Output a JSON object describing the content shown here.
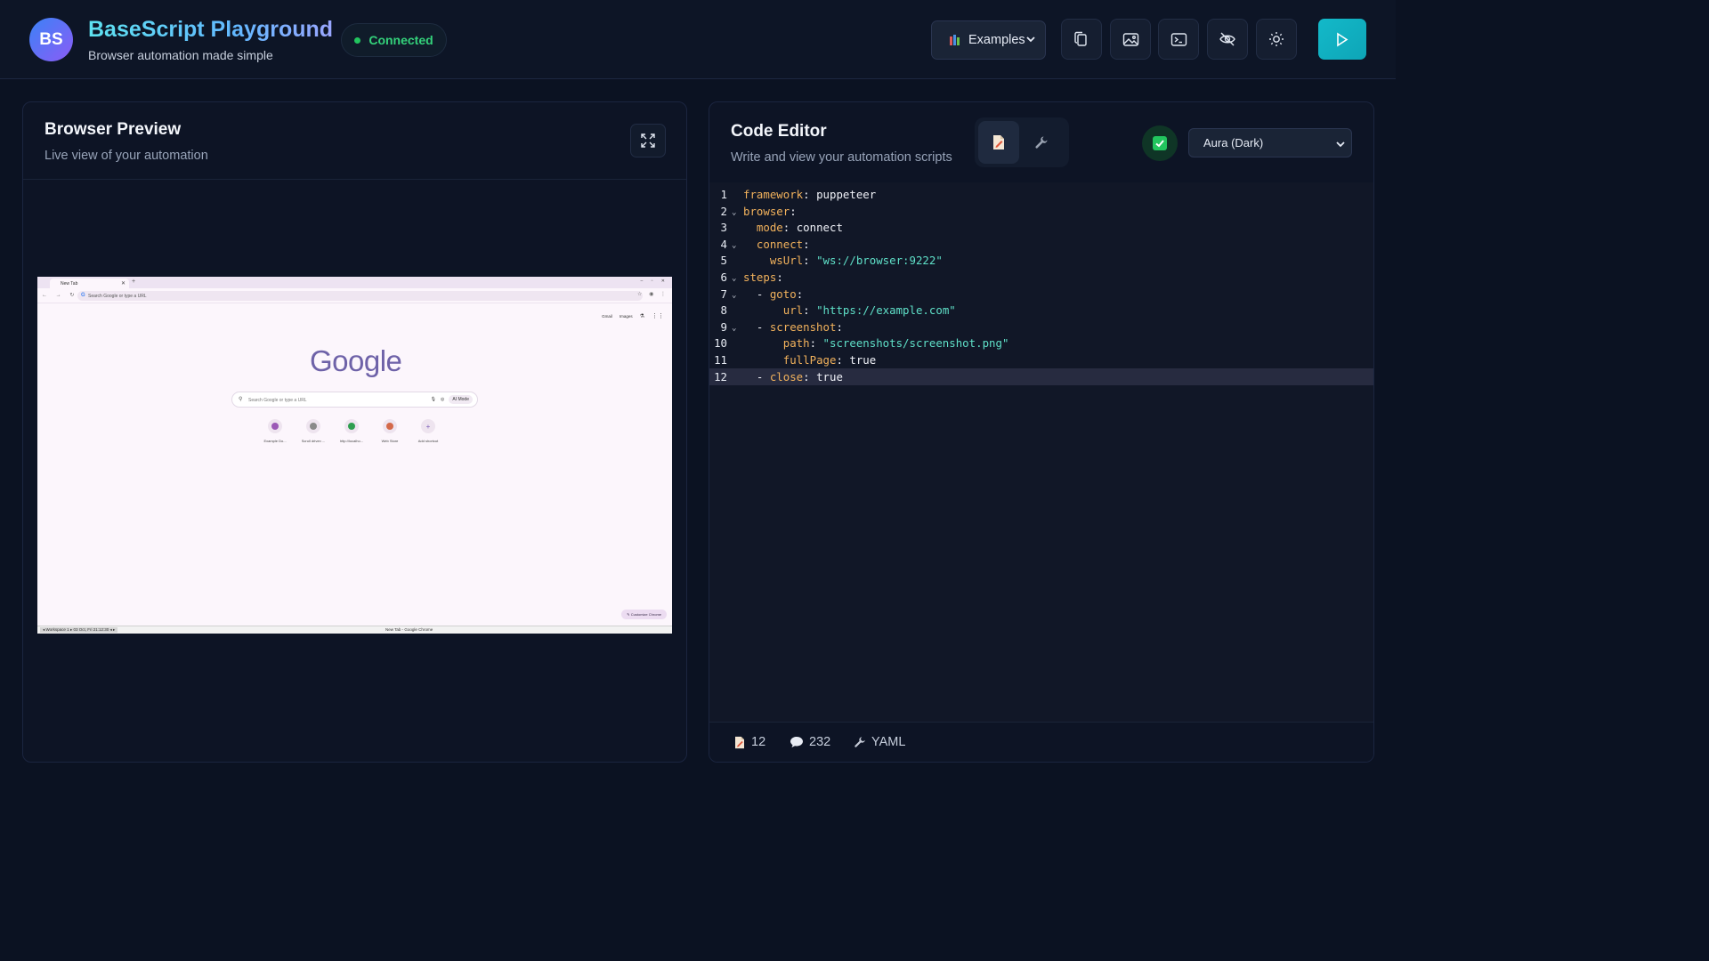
{
  "header": {
    "avatar_initials": "BS",
    "title": "BaseScript Playground",
    "subtitle": "Browser automation made simple",
    "status": "Connected",
    "examples_label": "Examples",
    "icons": [
      "copy-icon",
      "image-icon",
      "terminal-icon",
      "eye-off-icon",
      "sun-icon",
      "play-icon"
    ]
  },
  "preview": {
    "title": "Browser Preview",
    "subtitle": "Live view of your automation",
    "browser": {
      "tab_title": "New Tab",
      "omnibox_placeholder": "Search Google or type a URL",
      "top_links": [
        "Gmail",
        "Images"
      ],
      "logo": "Google",
      "search_placeholder": "Search Google or type a URL",
      "ai_mode": "AI Mode",
      "shortcuts": [
        {
          "label": "Example Do...",
          "color": "#9b59b6"
        },
        {
          "label": "Scroll driven ...",
          "color": "#8a8a8a"
        },
        {
          "label": "http://localho...",
          "color": "#2e9e4f"
        },
        {
          "label": "Web Store",
          "color": "#d4694a"
        },
        {
          "label": "Add shortcut",
          "color": "#7a5ab8"
        }
      ],
      "customize": "Customize Chrome",
      "taskbar_left": "◂ Workspace 1 ▸   03 Oct, Fri 21:12:30   ◂ ▸",
      "taskbar_center": "New Tab - Google Chrome"
    }
  },
  "editor": {
    "title": "Code Editor",
    "subtitle": "Write and view your automation scripts",
    "theme": "Aura (Dark)",
    "lines": [
      {
        "n": "1",
        "fold": false,
        "indent": "",
        "key": "framework",
        "sep": ": ",
        "value": "puppeteer",
        "vtype": "plain"
      },
      {
        "n": "2",
        "fold": true,
        "indent": "",
        "key": "browser",
        "sep": ":",
        "value": "",
        "vtype": "plain"
      },
      {
        "n": "3",
        "fold": false,
        "indent": "  ",
        "key": "mode",
        "sep": ": ",
        "value": "connect",
        "vtype": "plain"
      },
      {
        "n": "4",
        "fold": true,
        "indent": "  ",
        "key": "connect",
        "sep": ":",
        "value": "",
        "vtype": "plain"
      },
      {
        "n": "5",
        "fold": false,
        "indent": "    ",
        "key": "wsUrl",
        "sep": ": ",
        "value": "\"ws://browser:9222\"",
        "vtype": "str"
      },
      {
        "n": "6",
        "fold": true,
        "indent": "",
        "key": "steps",
        "sep": ":",
        "value": "",
        "vtype": "plain"
      },
      {
        "n": "7",
        "fold": true,
        "indent": "  - ",
        "key": "goto",
        "sep": ":",
        "value": "",
        "vtype": "plain"
      },
      {
        "n": "8",
        "fold": false,
        "indent": "      ",
        "key": "url",
        "sep": ": ",
        "value": "\"https://example.com\"",
        "vtype": "str"
      },
      {
        "n": "9",
        "fold": true,
        "indent": "  - ",
        "key": "screenshot",
        "sep": ":",
        "value": "",
        "vtype": "plain"
      },
      {
        "n": "10",
        "fold": false,
        "indent": "      ",
        "key": "path",
        "sep": ": ",
        "value": "\"screenshots/screenshot.png\"",
        "vtype": "str"
      },
      {
        "n": "11",
        "fold": false,
        "indent": "      ",
        "key": "fullPage",
        "sep": ": ",
        "value": "true",
        "vtype": "plain"
      },
      {
        "n": "12",
        "fold": false,
        "indent": "  - ",
        "key": "close",
        "sep": ": ",
        "value": "true",
        "vtype": "plain"
      }
    ],
    "active_line": "12",
    "footer": {
      "lines": "12",
      "chars": "232",
      "language": "YAML"
    }
  }
}
